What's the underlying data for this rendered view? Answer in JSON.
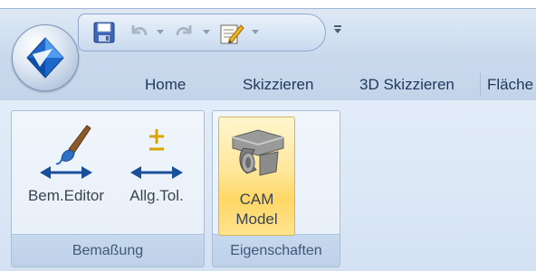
{
  "quick_access": {
    "save_icon": "floppy-disk-icon",
    "undo_icon": "undo-arrow-icon",
    "redo_icon": "redo-arrow-icon",
    "properties_icon": "properties-document-icon",
    "customize_icon": "customize-toolbar-dropdown-icon"
  },
  "app_button": {
    "icon": "app-logo-icon"
  },
  "tabs": [
    {
      "label": "Home"
    },
    {
      "label": "Skizzieren"
    },
    {
      "label": "3D Skizzieren"
    },
    {
      "label": "Fläche"
    }
  ],
  "groups": [
    {
      "caption": "Bemaßung",
      "buttons": [
        {
          "label": "Bem.Editor",
          "icon": "brush-dimension-icon"
        },
        {
          "label": "Allg.Tol.",
          "icon": "tolerance-dimension-icon"
        }
      ]
    },
    {
      "caption": "Eigenschaften",
      "buttons": [
        {
          "label_line1": "CAM",
          "label_line2": "Model",
          "icon": "cam-model-icon",
          "state": "highlighted"
        }
      ]
    }
  ],
  "colors": {
    "accent_blue": "#1b63b8",
    "tab_text": "#1e395b",
    "highlight": "#ffd766"
  }
}
